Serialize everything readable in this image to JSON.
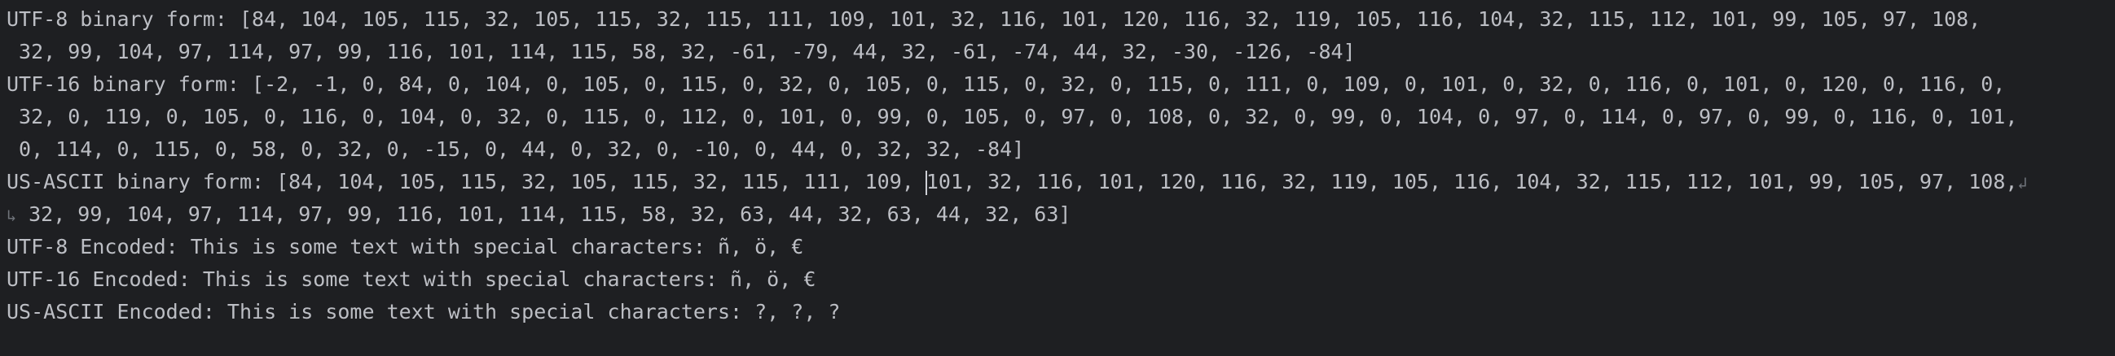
{
  "console": {
    "lines": [
      "UTF-8 binary form: [84, 104, 105, 115, 32, 105, 115, 32, 115, 111, 109, 101, 32, 116, 101, 120, 116, 32, 119, 105, 116, 104, 32, 115, 112, 101, 99, 105, 97, 108,",
      " 32, 99, 104, 97, 114, 97, 99, 116, 101, 114, 115, 58, 32, -61, -79, 44, 32, -61, -74, 44, 32, -30, -126, -84]",
      "UTF-16 binary form: [-2, -1, 0, 84, 0, 104, 0, 105, 0, 115, 0, 32, 0, 105, 0, 115, 0, 32, 0, 115, 0, 111, 0, 109, 0, 101, 0, 32, 0, 116, 0, 101, 0, 120, 0, 116, 0,",
      " 32, 0, 119, 0, 105, 0, 116, 0, 104, 0, 32, 0, 115, 0, 112, 0, 101, 0, 99, 0, 105, 0, 97, 0, 108, 0, 32, 0, 99, 0, 104, 0, 97, 0, 114, 0, 97, 0, 99, 0, 116, 0, 101,",
      " 0, 114, 0, 115, 0, 58, 0, 32, 0, -15, 0, 44, 0, 32, 0, -10, 0, 44, 0, 32, 32, -84]"
    ],
    "ascii_line_a_before_caret": "US-ASCII binary form: [84, 104, 105, 115, 32, 105, 115, 32, 115, 111, 109, ",
    "ascii_line_a_after_caret": "101, 32, 116, 101, 120, 116, 32, 119, 105, 116, 104, 32, 115, 112, 101, 99, 105, 97, 108,",
    "ascii_line_b": " 32, 99, 104, 97, 114, 97, 99, 116, 101, 114, 115, 58, 32, 63, 44, 32, 63, 44, 32, 63]",
    "encoded_lines": [
      "UTF-8 Encoded: This is some text with special characters: ñ, ö, €",
      "UTF-16 Encoded: This is some text with special characters: ñ, ö, €",
      "US-ASCII Encoded: This is some text with special characters: ?, ?, ?"
    ],
    "icons": {
      "wrap_end": "soft-wrap-end-icon",
      "wrap_start": "soft-wrap-start-icon"
    },
    "colors": {
      "background": "#1e1f22",
      "text": "#bcbec4"
    }
  }
}
